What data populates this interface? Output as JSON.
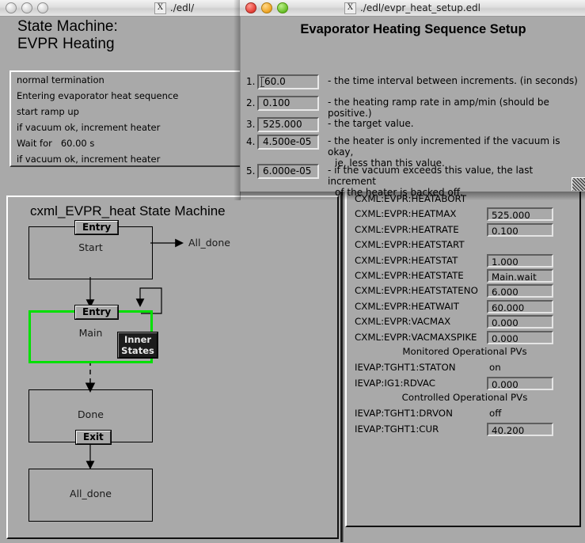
{
  "bg_window": {
    "titlebar": {
      "x_icon": "x-icon",
      "title": "./edl/"
    },
    "heading_line1": "State Machine:",
    "heading_line2": "EVPR Heating",
    "message_log": [
      "normal termination",
      "Entering evaporator heat sequence",
      "start ramp up",
      "if vacuum ok, increment heater",
      "Wait for   60.00 s",
      "if vacuum ok, increment heater"
    ],
    "state_machine": {
      "title": "cxml_EVPR_heat State Machine",
      "states": [
        {
          "name": "Start",
          "tag": "Entry",
          "active": false
        },
        {
          "name": "Main",
          "tag": "Entry",
          "active": true,
          "inner_label_1": "Inner",
          "inner_label_2": "States"
        },
        {
          "name": "Done",
          "tag": "Exit",
          "active": false
        },
        {
          "name": "All_done",
          "tag": "",
          "active": false
        }
      ],
      "edge_label": "All_done"
    }
  },
  "pv_window": {
    "rows": [
      {
        "type": "pv",
        "name": "CXML:EVPR:HEATABORT",
        "value": null,
        "field": false
      },
      {
        "type": "pv",
        "name": "CXML:EVPR:HEATMAX",
        "value": "525.000",
        "field": true
      },
      {
        "type": "pv",
        "name": "CXML:EVPR:HEATRATE",
        "value": "0.100",
        "field": true
      },
      {
        "type": "pv",
        "name": "CXML:EVPR:HEATSTART",
        "value": null,
        "field": false
      },
      {
        "type": "pv",
        "name": "CXML:EVPR:HEATSTAT",
        "value": "1.000",
        "field": true
      },
      {
        "type": "pv",
        "name": "CXML:EVPR:HEATSTATE",
        "value": "Main.wait",
        "field": true
      },
      {
        "type": "pv",
        "name": "CXML:EVPR:HEATSTATENO",
        "value": "6.000",
        "field": true
      },
      {
        "type": "pv",
        "name": "CXML:EVPR:HEATWAIT",
        "value": "60.000",
        "field": true
      },
      {
        "type": "pv",
        "name": "CXML:EVPR:VACMAX",
        "value": "0.000",
        "field": true
      },
      {
        "type": "pv",
        "name": "CXML:EVPR:VACMAXSPIKE",
        "value": "0.000",
        "field": true
      },
      {
        "type": "section",
        "name": "Monitored Operational PVs"
      },
      {
        "type": "pv",
        "name": "IEVAP:TGHT1:STATON",
        "value": "on",
        "field": false
      },
      {
        "type": "pv",
        "name": "IEVAP:IG1:RDVAC",
        "value": "0.000",
        "field": true
      },
      {
        "type": "section",
        "name": "Controlled Operational PVs"
      },
      {
        "type": "pv",
        "name": "IEVAP:TGHT1:DRVON",
        "value": "off",
        "field": false
      },
      {
        "type": "pv",
        "name": "IEVAP:TGHT1:CUR",
        "value": "40.200",
        "field": true
      }
    ]
  },
  "dialog": {
    "titlebar": {
      "close_label": "close-button",
      "minimize_label": "minimize-button",
      "maximize_label": "maximize-button",
      "x_icon": "x-icon",
      "title": "./edl/evpr_heat_setup.edl"
    },
    "heading": "Evaporator Heating Sequence Setup",
    "entries": [
      {
        "num": "1.",
        "value": "60.0",
        "desc": "- the time interval between increments. (in seconds)",
        "desc2": "",
        "focused": true
      },
      {
        "num": "2.",
        "value": "0.100",
        "desc": "- the heating ramp rate in amp/min (should be positive.)",
        "desc2": "",
        "focused": false
      },
      {
        "num": "3.",
        "value": "525.000",
        "desc": "- the target value.",
        "desc2": "",
        "focused": false
      },
      {
        "num": "4.",
        "value": "4.500e-05",
        "desc": "- the heater is only incremented if the vacuum is okay,",
        "desc2": "ie, less than this value.",
        "focused": false
      },
      {
        "num": "5.",
        "value": "6.000e-05",
        "desc": "- if the vacuum exceeds this value, the last increment",
        "desc2": "of the heater is backed off.",
        "focused": false
      }
    ],
    "resize_grip": "resize-grip"
  },
  "colors": {
    "window_bg": "#a9a9a9",
    "active_state_outline": "#00e000",
    "text": "#000000"
  }
}
